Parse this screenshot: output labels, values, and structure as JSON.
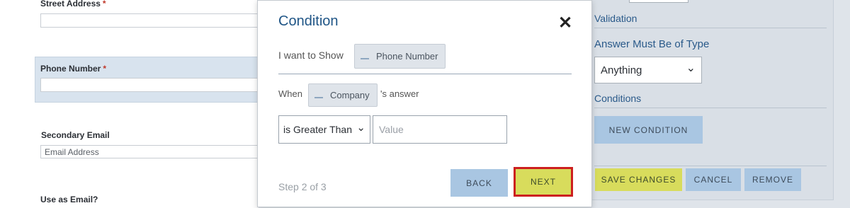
{
  "form": {
    "street_address_label": "Street Address",
    "required_mark": "*",
    "phone_number_label": "Phone Number",
    "secondary_email_label": "Secondary Email",
    "secondary_email_placeholder": "Email Address",
    "use_as_email_label": "Use as Email?"
  },
  "modal": {
    "title": "Condition",
    "close_glyph": "✕",
    "show_label": "I want to Show",
    "show_field": "Phone Number",
    "when_label": "When",
    "when_field": "Company",
    "answer_suffix": "'s answer",
    "operator_value": "is Greater Than",
    "value_placeholder": "Value",
    "step_text": "Step 2 of 3",
    "back_label": "BACK",
    "next_label": "NEXT"
  },
  "right_panel": {
    "validation_title": "Validation",
    "answer_type_title": "Answer Must Be of Type",
    "answer_type_value": "Anything",
    "conditions_title": "Conditions",
    "new_condition_label": "NEW CONDITION",
    "save_label": "SAVE CHANGES",
    "cancel_label": "CANCEL",
    "remove_label": "REMOVE"
  },
  "icons": {
    "chevron": "⌄"
  },
  "colors": {
    "accent_blue": "#1f5586",
    "button_blue": "#a9c6e2",
    "button_yellow": "#d8dc5c",
    "focus_red": "#cc1f1f"
  }
}
